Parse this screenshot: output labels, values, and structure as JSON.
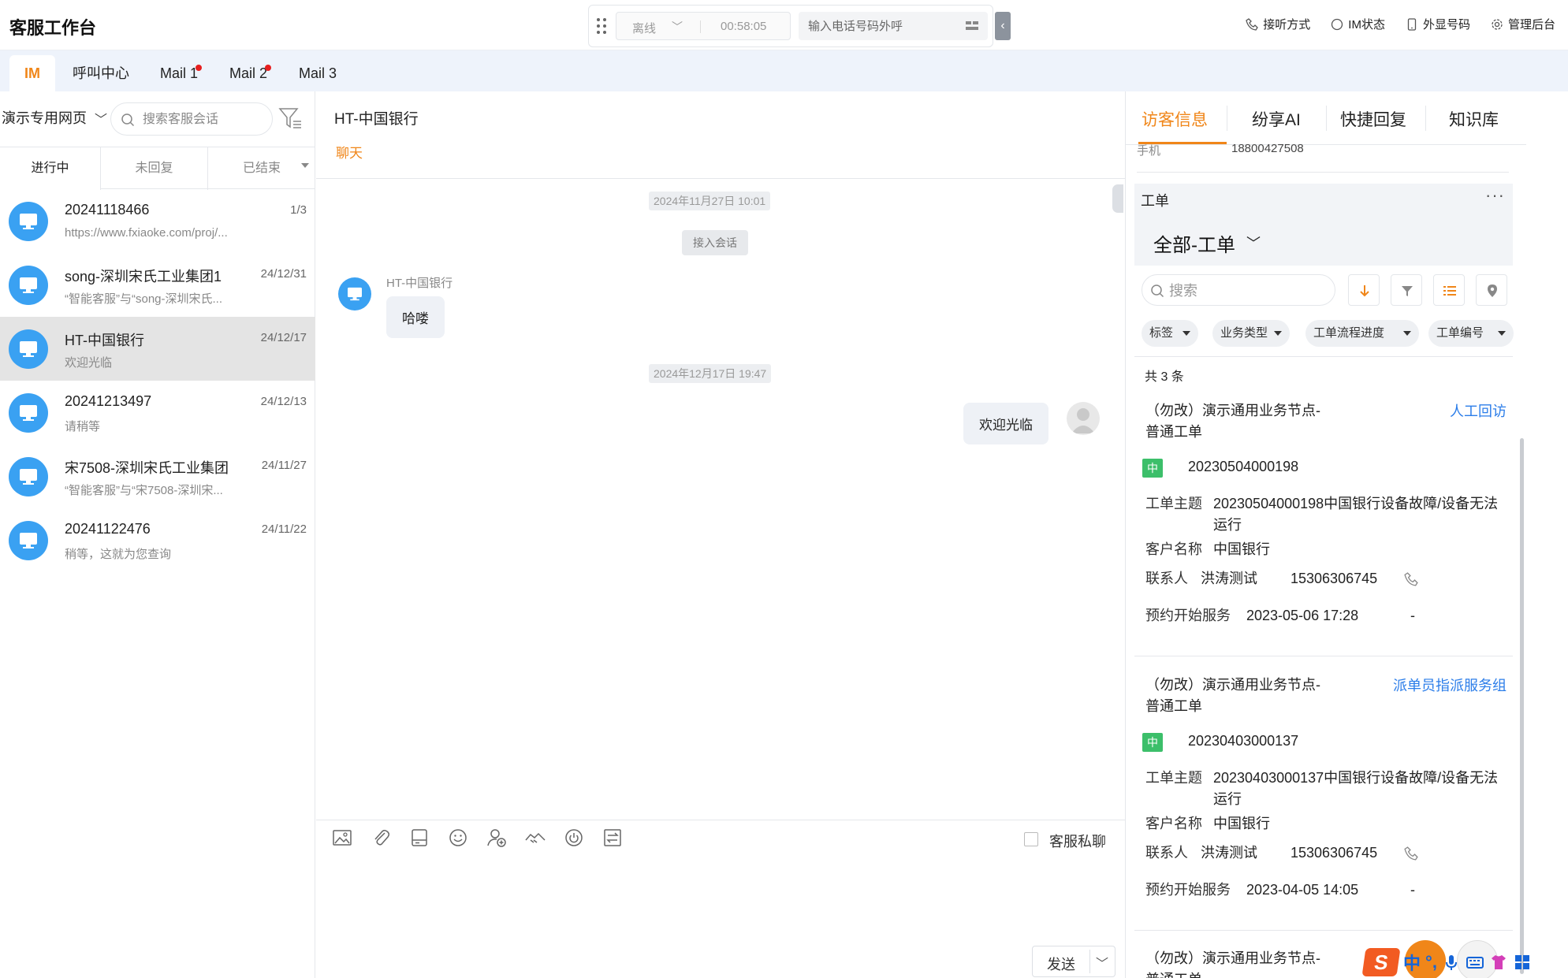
{
  "app": {
    "title": "客服工作台"
  },
  "callbar": {
    "status": "离线",
    "timer": "00:58:05",
    "dial_placeholder": "输入电话号码外呼"
  },
  "top_actions": [
    {
      "label": "接听方式",
      "icon": "phone-answer-icon"
    },
    {
      "label": "IM状态",
      "icon": "circle-status-icon"
    },
    {
      "label": "外显号码",
      "icon": "mobile-icon"
    },
    {
      "label": "管理后台",
      "icon": "gear-icon"
    }
  ],
  "tabs": [
    {
      "label": "IM",
      "active": true,
      "badge": false
    },
    {
      "label": "呼叫中心",
      "active": false,
      "badge": false
    },
    {
      "label": "Mail 1",
      "active": false,
      "badge": true
    },
    {
      "label": "Mail 2",
      "active": false,
      "badge": true
    },
    {
      "label": "Mail 3",
      "active": false,
      "badge": false
    }
  ],
  "left": {
    "site_select": "演示专用网页",
    "search_placeholder": "搜索客服会话",
    "conv_tabs": [
      "进行中",
      "未回复",
      "已结束"
    ],
    "conversations": [
      {
        "name": "20241118466",
        "time": "1/3",
        "preview": "https://www.fxiaoke.com/proj/...",
        "selected": false
      },
      {
        "name": "song-深圳宋氏工业集团1",
        "time": "24/12/31",
        "preview": "“智能客服”与“song-深圳宋氏...",
        "selected": false
      },
      {
        "name": "HT-中国银行",
        "time": "24/12/17",
        "preview": "欢迎光临",
        "selected": true
      },
      {
        "name": "20241213497",
        "time": "24/12/13",
        "preview": "请稍等",
        "selected": false
      },
      {
        "name": "宋7508-深圳宋氏工业集团",
        "time": "24/11/27",
        "preview": "“智能客服”与“宋7508-深圳宋...",
        "selected": false
      },
      {
        "name": "20241122476",
        "time": "24/11/22",
        "preview": "稍等，这就为您查询",
        "selected": false
      }
    ]
  },
  "chat": {
    "title": "HT-中国银行",
    "subtab": "聊天",
    "time1": "2024年11月27日 10:01",
    "system_msg": "接入会话",
    "sender": "HT-中国银行",
    "visitor_msg": "哈喽",
    "time2": "2024年12月17日 19:47",
    "agent_msg": "欢迎光临",
    "private_label": "客服私聊",
    "send_label": "发送",
    "tools": [
      "image-icon",
      "paperclip-icon",
      "disk-icon",
      "emoji-icon",
      "user-add-icon",
      "handshake-icon",
      "power-icon",
      "transfer-icon"
    ]
  },
  "right": {
    "tabs": [
      "访客信息",
      "纷享AI",
      "快捷回复",
      "知识库"
    ],
    "phone_label": "手机",
    "phone_value": "18800427508",
    "wo_title": "工单",
    "wo_all": "全部-工单",
    "wo_search_placeholder": "搜索",
    "filters": [
      "标签",
      "业务类型",
      "工单流程进度",
      "工单编号"
    ],
    "count": "共 3 条",
    "cards": [
      {
        "name": "（勿改）演示通用业务节点-普通工单",
        "link": "人工回访",
        "priority": "中",
        "number": "20230504000198",
        "subject_label": "工单主题",
        "subject": "20230504000198中国银行设备故障/设备无法运行",
        "customer_label": "客户名称",
        "customer": "中国银行",
        "contact_label": "联系人",
        "contact": "洪涛测试",
        "contact_phone": "15306306745",
        "start_label": "预约开始服务",
        "start": "2023-05-06 17:28",
        "start_extra": "-"
      },
      {
        "name": "（勿改）演示通用业务节点-普通工单",
        "link": "派单员指派服务组",
        "priority": "中",
        "number": "20230403000137",
        "subject_label": "工单主题",
        "subject": "20230403000137中国银行设备故障/设备无法运行",
        "customer_label": "客户名称",
        "customer": "中国银行",
        "contact_label": "联系人",
        "contact": "洪涛测试",
        "contact_phone": "15306306745",
        "start_label": "预约开始服务",
        "start": "2023-04-05 14:05",
        "start_extra": "-"
      },
      {
        "name": "（勿改）演示通用业务节点-普通工单"
      }
    ]
  },
  "ime": {
    "logo": "S",
    "mode": "中",
    "punct": "°,"
  }
}
